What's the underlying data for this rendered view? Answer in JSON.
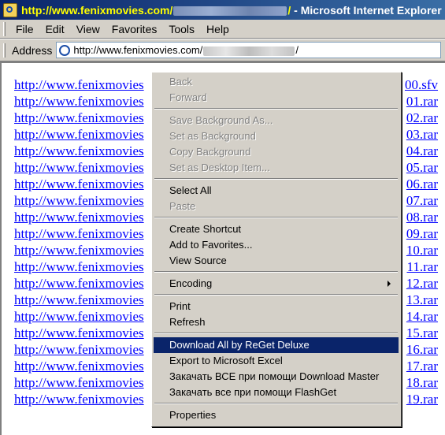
{
  "window": {
    "title_url_prefix": "http://www.fenixmovies.com/",
    "title_url_suffix": "/",
    "title_suffix": " - Microsoft Internet Explorer"
  },
  "menubar": {
    "items": [
      "File",
      "Edit",
      "View",
      "Favorites",
      "Tools",
      "Help"
    ]
  },
  "address": {
    "label": "Address",
    "url_prefix": "http://www.fenixmovies.com/",
    "url_suffix": "/"
  },
  "links": [
    {
      "left": "http://www.fenixmovies",
      "right": "00.sfv"
    },
    {
      "left": "http://www.fenixmovies",
      "right": "01.rar"
    },
    {
      "left": "http://www.fenixmovies",
      "right": "02.rar"
    },
    {
      "left": "http://www.fenixmovies",
      "right": "03.rar"
    },
    {
      "left": "http://www.fenixmovies",
      "right": "04.rar"
    },
    {
      "left": "http://www.fenixmovies",
      "right": "05.rar"
    },
    {
      "left": "http://www.fenixmovies",
      "right": "06.rar"
    },
    {
      "left": "http://www.fenixmovies",
      "right": "07.rar"
    },
    {
      "left": "http://www.fenixmovies",
      "right": "08.rar"
    },
    {
      "left": "http://www.fenixmovies",
      "right": "09.rar"
    },
    {
      "left": "http://www.fenixmovies",
      "right": "10.rar"
    },
    {
      "left": "http://www.fenixmovies",
      "right": "11.rar"
    },
    {
      "left": "http://www.fenixmovies",
      "right": "12.rar"
    },
    {
      "left": "http://www.fenixmovies",
      "right": "13.rar"
    },
    {
      "left": "http://www.fenixmovies",
      "right": "14.rar"
    },
    {
      "left": "http://www.fenixmovies",
      "right": "15.rar"
    },
    {
      "left": "http://www.fenixmovies",
      "right": "16.rar"
    },
    {
      "left": "http://www.fenixmovies",
      "right": "17.rar"
    },
    {
      "left": "http://www.fenixmovies",
      "right": "18.rar"
    },
    {
      "left": "http://www.fenixmovies",
      "right": "19.rar"
    }
  ],
  "context_menu": {
    "back": "Back",
    "forward": "Forward",
    "save_background_as": "Save Background As...",
    "set_as_background": "Set as Background",
    "copy_background": "Copy Background",
    "set_as_desktop_item": "Set as Desktop Item...",
    "select_all": "Select All",
    "paste": "Paste",
    "create_shortcut": "Create Shortcut",
    "add_to_favorites": "Add to Favorites...",
    "view_source": "View Source",
    "encoding": "Encoding",
    "print": "Print",
    "refresh": "Refresh",
    "download_all_reget": "Download All by ReGet Deluxe",
    "export_to_excel": "Export to Microsoft Excel",
    "download_master": "Закачать ВСЕ при помощи Download Master",
    "flashget": "Закачать все при помощи FlashGet",
    "properties": "Properties"
  },
  "colors": {
    "titlebar": "#0a246a",
    "title_url": "#ffff00",
    "link": "#0000ff",
    "highlight": "#0a246a"
  }
}
